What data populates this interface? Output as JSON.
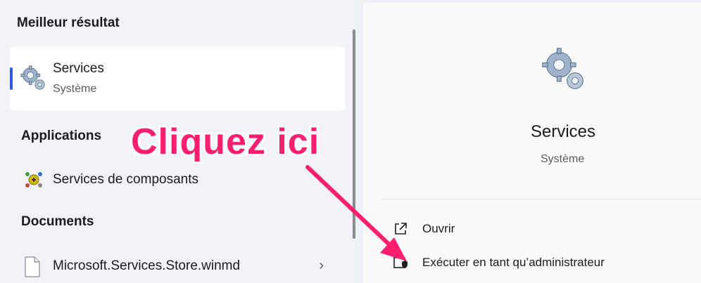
{
  "left_panel": {
    "best_title": "Meilleur résultat",
    "best": {
      "name": "Services",
      "sub": "Système",
      "icon": "gears-icon"
    },
    "applications_title": "Applications",
    "applications": [
      {
        "label": "Services de composants",
        "icon": "component-services-icon"
      }
    ],
    "documents_title": "Documents",
    "documents": [
      {
        "label": "Microsoft.Services.Store.winmd",
        "icon": "file-icon"
      }
    ]
  },
  "right_panel": {
    "title": "Services",
    "sub": "Système",
    "actions": [
      {
        "label": "Ouvrir",
        "icon": "open-external-icon"
      },
      {
        "label": "Exécuter en tant qu’administrateur",
        "icon": "shield-admin-icon"
      }
    ]
  },
  "overlay": {
    "text": "Cliquez ici",
    "color": "#ff1f6e"
  },
  "colors": {
    "accent": "#2f5be0"
  }
}
